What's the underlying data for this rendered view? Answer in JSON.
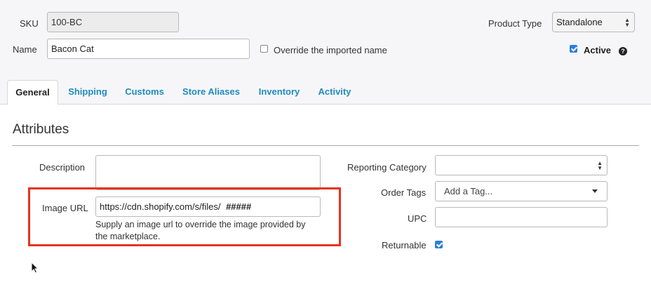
{
  "header": {
    "sku_label": "SKU",
    "sku_value": "100-BC",
    "name_label": "Name",
    "name_value": "Bacon Cat",
    "override_label": "Override the imported name",
    "product_type_label": "Product Type",
    "product_type_value": "Standalone",
    "active_label": "Active",
    "help_glyph": "?"
  },
  "tabs": [
    {
      "label": "General",
      "active": true
    },
    {
      "label": "Shipping"
    },
    {
      "label": "Customs"
    },
    {
      "label": "Store Aliases"
    },
    {
      "label": "Inventory"
    },
    {
      "label": "Activity"
    }
  ],
  "attributes": {
    "section_title": "Attributes",
    "description_label": "Description",
    "description_value": "",
    "image_url_label": "Image URL",
    "image_url_value": "https://cdn.shopify.com/s/files/",
    "image_url_masked": "#####",
    "image_url_help": "Supply an image url to override the image provided by the marketplace.",
    "reporting_category_label": "Reporting Category",
    "reporting_category_value": "",
    "order_tags_label": "Order Tags",
    "order_tags_placeholder": "Add a Tag...",
    "upc_label": "UPC",
    "upc_value": "",
    "returnable_label": "Returnable"
  },
  "colors": {
    "highlight_box": "#e8321e",
    "tab_link": "#1f8ac0",
    "checkbox_checked": "#2a7ed8"
  }
}
